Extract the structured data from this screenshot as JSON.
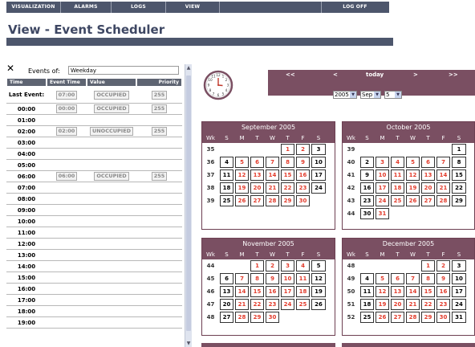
{
  "nav": {
    "items": [
      "VISUALIZATION",
      "ALARMS",
      "LOGS",
      "VIEW",
      "LOG OFF"
    ],
    "bg": "#4d566c"
  },
  "title": "View - Event Scheduler",
  "events": {
    "label": "Events of:",
    "value": "Weekday",
    "columns": [
      "Time",
      "Event Time",
      "Value",
      "Priority"
    ],
    "last_event": {
      "label": "Last Event:",
      "time": "07:00",
      "value": "OCCUPIED",
      "priority": "255"
    },
    "rows": [
      {
        "time": "00:00",
        "event_time": "00:00",
        "value": "OCCUPIED",
        "priority": "255"
      },
      {
        "time": "01:00"
      },
      {
        "time": "02:00",
        "event_time": "02:00",
        "value": "UNOCCUPIED",
        "priority": "255"
      },
      {
        "time": "03:00"
      },
      {
        "time": "04:00"
      },
      {
        "time": "05:00"
      },
      {
        "time": "06:00",
        "event_time": "06:00",
        "value": "OCCUPIED",
        "priority": "255"
      },
      {
        "time": "07:00"
      },
      {
        "time": "08:00"
      },
      {
        "time": "09:00"
      },
      {
        "time": "10:00"
      },
      {
        "time": "11:00"
      },
      {
        "time": "12:00"
      },
      {
        "time": "13:00"
      },
      {
        "time": "14:00"
      },
      {
        "time": "15:00"
      },
      {
        "time": "16:00"
      },
      {
        "time": "17:00"
      },
      {
        "time": "18:00"
      },
      {
        "time": "19:00"
      }
    ]
  },
  "calendar_nav": {
    "first": "<<",
    "prev": "<",
    "today": "today",
    "next": ">",
    "last": ">>",
    "year": "2005",
    "month": "Sep",
    "day": "5"
  },
  "calendars": {
    "sep": {
      "title": "September 2005",
      "weeks": [
        {
          "wk": "35",
          "days": [
            "",
            "",
            "",
            "",
            "1",
            "2",
            "3"
          ]
        },
        {
          "wk": "36",
          "days": [
            "4",
            "5",
            "6",
            "7",
            "8",
            "9",
            "10"
          ]
        },
        {
          "wk": "37",
          "days": [
            "11",
            "12",
            "13",
            "14",
            "15",
            "16",
            "17"
          ]
        },
        {
          "wk": "38",
          "days": [
            "18",
            "19",
            "20",
            "21",
            "22",
            "23",
            "24"
          ]
        },
        {
          "wk": "39",
          "days": [
            "25",
            "26",
            "27",
            "28",
            "29",
            "30",
            ""
          ]
        }
      ]
    },
    "oct": {
      "title": "October 2005",
      "weeks": [
        {
          "wk": "39",
          "days": [
            "",
            "",
            "",
            "",
            "",
            "",
            "1"
          ]
        },
        {
          "wk": "40",
          "days": [
            "2",
            "3",
            "4",
            "5",
            "6",
            "7",
            "8"
          ]
        },
        {
          "wk": "41",
          "days": [
            "9",
            "10",
            "11",
            "12",
            "13",
            "14",
            "15"
          ]
        },
        {
          "wk": "42",
          "days": [
            "16",
            "17",
            "18",
            "19",
            "20",
            "21",
            "22"
          ]
        },
        {
          "wk": "43",
          "days": [
            "23",
            "24",
            "25",
            "26",
            "27",
            "28",
            "29"
          ]
        },
        {
          "wk": "44",
          "days": [
            "30",
            "31",
            "",
            "",
            "",
            "",
            ""
          ]
        }
      ]
    },
    "nov": {
      "title": "November 2005",
      "weeks": [
        {
          "wk": "44",
          "days": [
            "",
            "",
            "1",
            "2",
            "3",
            "4",
            "5"
          ]
        },
        {
          "wk": "45",
          "days": [
            "6",
            "7",
            "8",
            "9",
            "10",
            "11",
            "12"
          ]
        },
        {
          "wk": "46",
          "days": [
            "13",
            "14",
            "15",
            "16",
            "17",
            "18",
            "19"
          ]
        },
        {
          "wk": "47",
          "days": [
            "20",
            "21",
            "22",
            "23",
            "24",
            "25",
            "26"
          ]
        },
        {
          "wk": "48",
          "days": [
            "27",
            "28",
            "29",
            "30",
            "",
            "",
            ""
          ]
        }
      ]
    },
    "dec": {
      "title": "December 2005",
      "weeks": [
        {
          "wk": "48",
          "days": [
            "",
            "",
            "",
            "",
            "1",
            "2",
            "3"
          ]
        },
        {
          "wk": "49",
          "days": [
            "4",
            "5",
            "6",
            "7",
            "8",
            "9",
            "10"
          ]
        },
        {
          "wk": "50",
          "days": [
            "11",
            "12",
            "13",
            "14",
            "15",
            "16",
            "17"
          ]
        },
        {
          "wk": "51",
          "days": [
            "18",
            "19",
            "20",
            "21",
            "22",
            "23",
            "24"
          ]
        },
        {
          "wk": "52",
          "days": [
            "25",
            "26",
            "27",
            "28",
            "29",
            "30",
            "31"
          ]
        }
      ]
    },
    "day_headers": [
      "Wk",
      "S",
      "M",
      "T",
      "W",
      "T",
      "F",
      "S"
    ]
  },
  "colors": {
    "calendar_header": "#7a4f62",
    "weekday_text": "#e23c2c",
    "weekend_text": "#000000"
  }
}
